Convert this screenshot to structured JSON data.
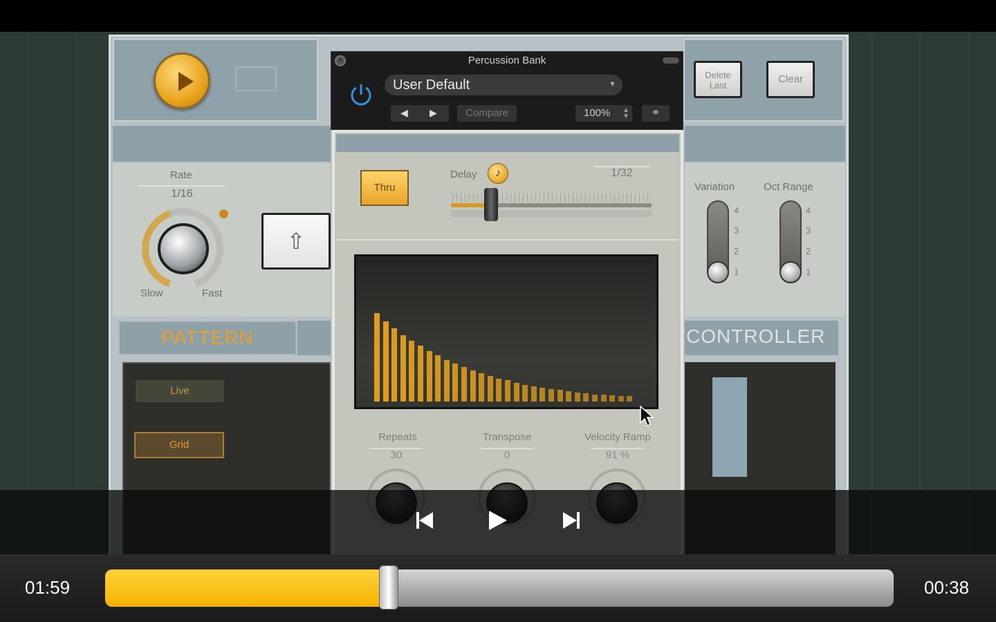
{
  "plugin": {
    "window_title": "Percussion Bank",
    "preset": "User Default",
    "compare_label": "Compare",
    "zoom": "100%",
    "delete_last_label": "Delete Last",
    "clear_label": "Clear",
    "thru_label": "Thru",
    "delay_label": "Delay",
    "delay_value": "1/32",
    "delay_fraction": 0.2,
    "rate_label": "Rate",
    "rate_value": "1/16",
    "slow_label": "Slow",
    "fast_label": "Fast",
    "pattern_title": "PATTERN",
    "controller_title": "CONTROLLER",
    "live_label": "Live",
    "grid_label": "Grid",
    "variation_label": "Variation",
    "oct_range_label": "Oct Range",
    "slider_scale": [
      "4",
      "3",
      "2",
      "1"
    ],
    "repeats_label": "Repeats",
    "repeats_value": "30",
    "transpose_label": "Transpose",
    "transpose_value": "0",
    "velocity_ramp_label": "Velocity Ramp",
    "velocity_ramp_value": "91 %",
    "accent_color": "#e9a41e",
    "display_bar_heights": [
      1.0,
      0.91,
      0.83,
      0.75,
      0.69,
      0.63,
      0.57,
      0.52,
      0.47,
      0.43,
      0.39,
      0.35,
      0.32,
      0.29,
      0.26,
      0.24,
      0.21,
      0.19,
      0.17,
      0.16,
      0.14,
      0.13,
      0.12,
      0.1,
      0.09,
      0.08,
      0.08,
      0.07,
      0.06,
      0.06
    ]
  },
  "player": {
    "elapsed": "01:59",
    "remaining": "00:38",
    "progress": 0.36,
    "progress_color": "#f3b200"
  },
  "icons": {
    "play": "play-icon",
    "prev": "skip-back-icon",
    "next": "skip-forward-icon",
    "power": "power-icon",
    "link": "link-icon",
    "note": "music-note-icon",
    "up_arrow": "arrow-up-icon"
  }
}
